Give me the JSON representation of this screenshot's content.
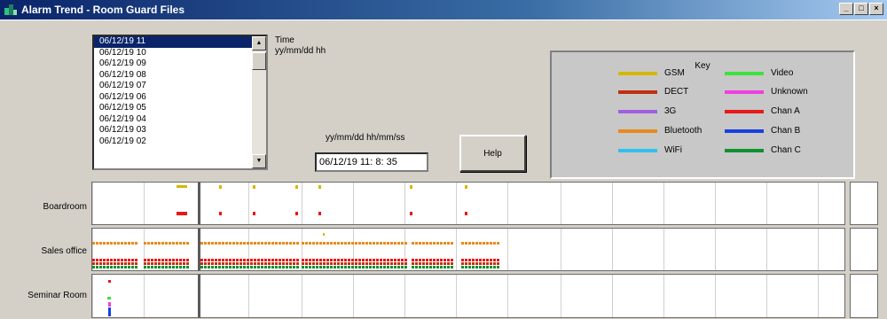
{
  "window": {
    "title": "Alarm Trend - Room Guard Files",
    "controls": [
      "_",
      "□",
      "×"
    ]
  },
  "listbox": {
    "items": [
      "06/12/19 11",
      "06/12/19 10",
      "06/12/19 09",
      "06/12/19 08",
      "06/12/19 07",
      "06/12/19 06",
      "06/12/19 05",
      "06/12/19 04",
      "06/12/19 03",
      "06/12/19 02"
    ],
    "selected_index": 0
  },
  "time_label": {
    "line1": "Time",
    "line2": "yy/mm/dd hh"
  },
  "datetime": {
    "label": "yy/mm/dd hh/mm/ss",
    "value": "06/12/19 11: 8: 35"
  },
  "help_button": {
    "label": "Help"
  },
  "key": {
    "title": "Key",
    "entries": [
      {
        "label": "GSM",
        "color": "#d4b800"
      },
      {
        "label": "DECT",
        "color": "#c03010"
      },
      {
        "label": "3G",
        "color": "#a060e0"
      },
      {
        "label": "Bluetooth",
        "color": "#e88a1c"
      },
      {
        "label": "WiFi",
        "color": "#30c0f0"
      },
      {
        "label": "Video",
        "color": "#40e040"
      },
      {
        "label": "Unknown",
        "color": "#f040e0"
      },
      {
        "label": "Chan A",
        "color": "#e81818"
      },
      {
        "label": "Chan B",
        "color": "#1840e0"
      },
      {
        "label": "Chan C",
        "color": "#109030"
      }
    ]
  },
  "rows": [
    {
      "label": "Boardroom"
    },
    {
      "label": "Sales office"
    },
    {
      "label": "Seminar Room"
    }
  ]
}
